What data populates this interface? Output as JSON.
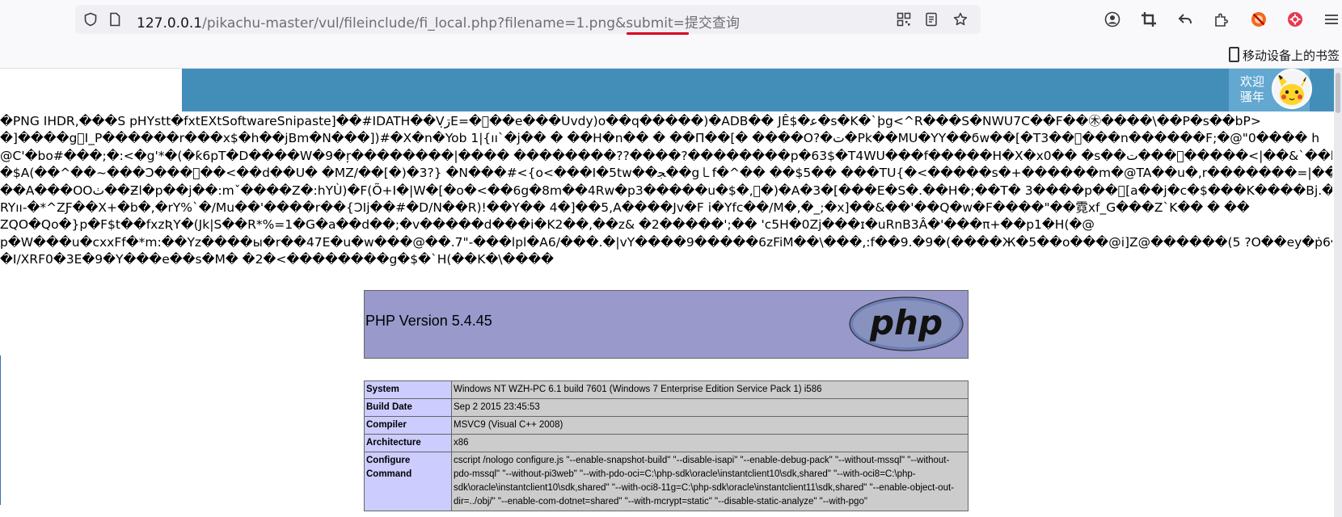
{
  "browser": {
    "url_host": "127.0.0.1",
    "url_path": "/pikachu-master/vul/fileinclude/fi_local.php?filename",
    "url_highlight": "=1.png&",
    "url_rest": "submit=提交查询",
    "bookmark_mobile": "移动设备上的书签",
    "icons": [
      "shield-icon",
      "page-info-icon",
      "qr-code-icon",
      "reader-view-icon",
      "bookmark-star-icon",
      "account-icon",
      "crop-icon",
      "back-arrow-icon",
      "extension-icon",
      "blocked-extension-icon",
      "red-extension-icon",
      "menu-icon"
    ]
  },
  "header": {
    "welcome_line1": "欢迎",
    "welcome_line2": "骚年",
    "band_color": "#438eb9",
    "accent_color": "#62a8d1"
  },
  "dump_lines": [
    "�PNG  IHDR,���S pHYstt�fxtEXtSoftwareSnipaste]��#IDATH��Vڗ̣E=�⃞��e���Uvdy)o��q�����)�ADB�� JÊ$�ﻋ�s�K�`þg<^R���S�NWU7C��F��㊍����\\��P�s��bP>",
    "�]����g⃞I_P������r���x$�h��jBm�N���])#�X�n�Yob 1|{ıı`�j�� � ��H�n�� � ��Π��[� ����O?�ت�Pk��MU�YY��ϭw��[�T3��⃞���n������F;�@\"0���� h",
    "@C'�bo#���;�:<�g'*�(�ƙ6pT�D����W�9�ŗ��������|���� ��������??����?��������p�63$�T4WU���f�����H�X�x0�� �s��ﺕ����⃞����<|��&`��h�\"",
    "�$A(��^��~���Ɔ���⃞��<��d��U� �MZ/��[�)�3?} �N���#<{o<���I�5tw��ﺠ��g㇄f�^�� ��$5�� ���TU{�<�����s�+������m�@TA��u�,r�������=|����/!Z�n",
    "��A���OOﭞ��Ƶl�p��j��:mˇ����Z�:hYÙ)�F(Õ+I�|W�[�o�<��6g�8m��4Rw�p3�����u�$�,⃞�)�A�3�[���E�S�.��H�;��T� 3����p��⃞[a��j�c�$���K����Bj.�+J�t",
    "RYıı-�*^ZƑ��X+�b�,�rY%`�/Mu��'����r��{ƆIj��#�D/N��R)!��Y�� 4�]��5,A����Jv�F i�Yfc��/M�,�_;�x]��&��'��Q�w�F����\"��霓xf_G���Z`K�� � ��",
    "ZQO�Qo�}p�F$t��fxzƦY�(Jk|S��R*%=1�G�a��d��;�v�����d���i�K2��,��z& �2�����';�� 'c5H�0Zj���ɪ�uRnB3Â�'���π+��p1�H(�@",
    "p�W���u�cxxFf�*m:��Yz����ы�r��47E�u�w���@��.7\"-���lpl�A6/���.�|vY����9�����6zFiM��\\���,:f��9.�9�(����Ж�5��o���@i]Z@������(5 ?O��ey�ṗ6�½�",
    "�I/XRF0�3E�9�Y���e��s�M� �2�<��������g�$�`H(��K�\\����"
  ],
  "phpinfo": {
    "version_label": "PHP Version 5.4.45",
    "logo_text": "php",
    "rows": [
      {
        "key": "System",
        "value": "Windows NT WZH-PC 6.1 build 7601 (Windows 7 Enterprise Edition Service Pack 1) i586"
      },
      {
        "key": "Build Date",
        "value": "Sep 2 2015 23:45:53"
      },
      {
        "key": "Compiler",
        "value": "MSVC9 (Visual C++ 2008)"
      },
      {
        "key": "Architecture",
        "value": "x86"
      },
      {
        "key": "Configure Command",
        "value": "cscript /nologo configure.js \"--enable-snapshot-build\" \"--disable-isapi\" \"--enable-debug-pack\" \"--without-mssql\" \"--without-pdo-mssql\" \"--without-pi3web\" \"--with-pdo-oci=C:\\php-sdk\\oracle\\instantclient10\\sdk,shared\" \"--with-oci8=C:\\php-sdk\\oracle\\instantclient10\\sdk,shared\" \"--with-oci8-11g=C:\\php-sdk\\oracle\\instantclient11\\sdk,shared\" \"--enable-object-out-dir=../obj/\" \"--enable-com-dotnet=shared\" \"--with-mcrypt=static\" \"--disable-static-analyze\" \"--with-pgo\""
      }
    ],
    "banner_color": "#9999cc",
    "key_color": "#ccccff",
    "value_color": "#cccccc"
  }
}
